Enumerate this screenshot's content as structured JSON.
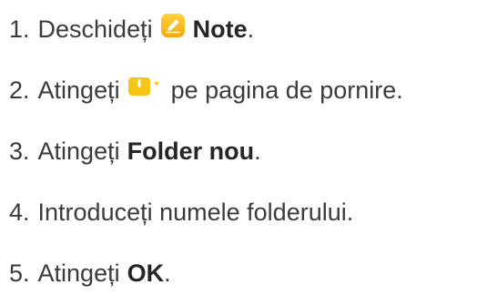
{
  "steps": [
    {
      "number": "1.",
      "before": "Deschideți",
      "icon": "notes-app-icon",
      "bold": "Note",
      "after": "."
    },
    {
      "number": "2.",
      "before": "Atingeți",
      "icon": "new-folder-menu-icon",
      "after": "pe pagina de pornire."
    },
    {
      "number": "3.",
      "before": "Atingeți",
      "bold": "Folder nou",
      "after": "."
    },
    {
      "number": "4.",
      "text": "Introduceți numele folderului."
    },
    {
      "number": "5.",
      "before": "Atingeți",
      "bold": "OK",
      "after": "."
    }
  ],
  "colors": {
    "text": "#3b3b3b",
    "bold_text": "#262626",
    "icon_accent": "#f6c21a"
  }
}
